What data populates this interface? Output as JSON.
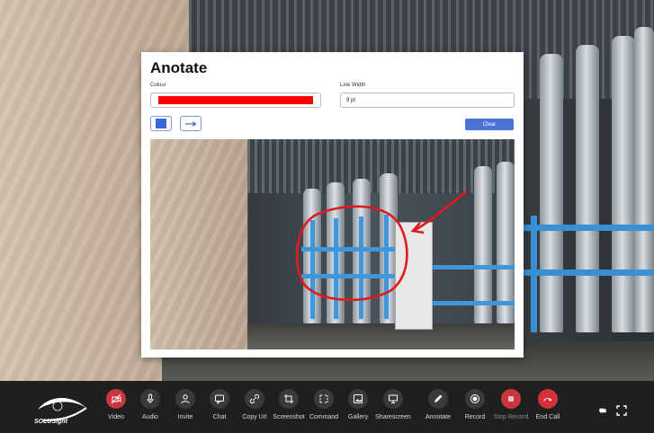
{
  "dialog": {
    "title": "Anotate",
    "colour_label": "Colour",
    "colour_value": "#ff0000",
    "line_width_label": "Line Width",
    "line_width_value": "9 pt",
    "clear_label": "Clear",
    "tool_color": "#3a68d8"
  },
  "toolbar": {
    "brand": "SOLUSight",
    "items": [
      {
        "label": "Video",
        "icon": "video-off-icon",
        "color": "#c9363e"
      },
      {
        "label": "Audio",
        "icon": "microphone-icon",
        "color": "#3a3a3a"
      },
      {
        "label": "Invite",
        "icon": "invite-user-icon",
        "color": "#3a3a3a"
      },
      {
        "label": "Chat",
        "icon": "chat-icon",
        "color": "#3a3a3a"
      },
      {
        "label": "Copy Url",
        "icon": "link-icon",
        "color": "#3a3a3a"
      },
      {
        "label": "Screenshot",
        "icon": "screenshot-icon",
        "color": "#3a3a3a"
      },
      {
        "label": "Command",
        "icon": "command-icon",
        "color": "#3a3a3a"
      },
      {
        "label": "Gallery",
        "icon": "gallery-icon",
        "color": "#3a3a3a"
      },
      {
        "label": "Sharescreen",
        "icon": "sharescreen-icon",
        "color": "#3a3a3a"
      },
      {
        "label": "Annotate",
        "icon": "pencil-icon",
        "color": "#3a3a3a"
      },
      {
        "label": "Record",
        "icon": "record-icon",
        "color": "#3a3a3a"
      },
      {
        "label": "Stop Record",
        "icon": "stop-icon",
        "color": "#c9363e"
      },
      {
        "label": "End Call",
        "icon": "phone-hangup-icon",
        "color": "#d7303a"
      }
    ]
  }
}
